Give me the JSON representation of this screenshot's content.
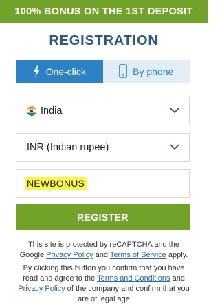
{
  "banner": {
    "text": "100% BONUS ON THE 1ST DEPOSIT"
  },
  "title": "REGISTRATION",
  "tabs": [
    {
      "label": "One-click",
      "icon": "lightning-icon",
      "active": true
    },
    {
      "label": "By phone",
      "icon": "phone-icon",
      "active": false
    }
  ],
  "country": {
    "value": "India",
    "icon": "india-flag-icon"
  },
  "currency": {
    "value": "INR (Indian rupee)"
  },
  "promo": {
    "value": "NEWBONUS"
  },
  "register_label": "REGISTER",
  "recaptcha": {
    "pre": "This site is protected by reCAPTCHA and the Google ",
    "privacy": "Privacy Policy",
    "mid": " and ",
    "terms": "Terms of Service",
    "post": " apply."
  },
  "consent": {
    "pre": "By clicking this button you confirm that you have read and agree to the ",
    "terms": "Terms and Conditions",
    "mid": " and ",
    "privacy": "Privacy Policy",
    "post": " of the company and confirm that you are of legal age"
  },
  "colors": {
    "accent_green": "#73a22b",
    "title_blue": "#2e5a7d",
    "tab_blue": "#2c82c5",
    "highlight_yellow": "#fbf64a"
  }
}
